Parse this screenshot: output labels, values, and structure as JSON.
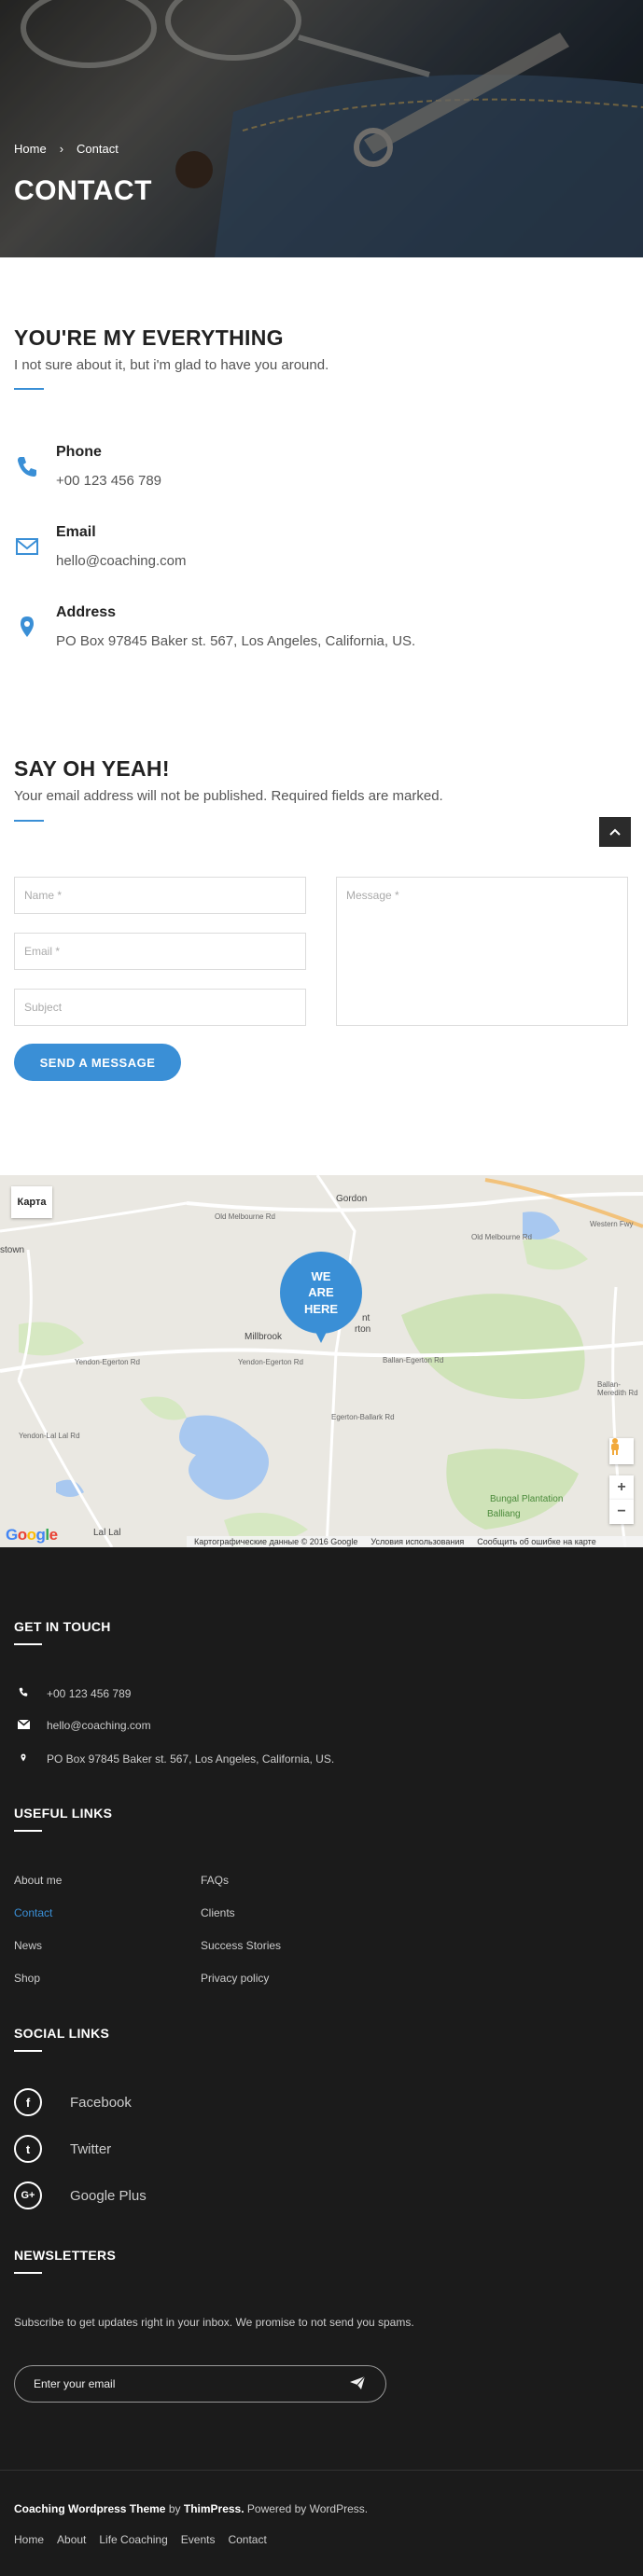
{
  "hero": {
    "breadcrumb": {
      "home": "Home",
      "separator": "›",
      "current": "Contact"
    },
    "title": "CONTACT"
  },
  "intro": {
    "title": "YOU'RE MY EVERYTHING",
    "subtitle": "I not sure about it, but i'm glad to have you around."
  },
  "contacts": [
    {
      "label": "Phone",
      "value": "+00 123 456 789",
      "icon": "phone-icon"
    },
    {
      "label": "Email",
      "value": "hello@coaching.com",
      "icon": "envelope-icon"
    },
    {
      "label": "Address",
      "value": "PO Box 97845 Baker st. 567, Los Angeles, California, US.",
      "icon": "map-pin-icon"
    }
  ],
  "form_section": {
    "title": "SAY OH YEAH!",
    "subtitle": "Your email address will not be published. Required fields are marked.",
    "name_placeholder": "Name *",
    "email_placeholder": "Email *",
    "subject_placeholder": "Subject",
    "message_placeholder": "Message *",
    "submit": "SEND A MESSAGE"
  },
  "map": {
    "type_button": "Карта",
    "marker": {
      "line1": "WE",
      "line2": "ARE",
      "line3": "HERE"
    },
    "places": [
      "Gordon",
      "Millbrook",
      "Lal Lal",
      "Bungal Plantation",
      "Balliang",
      "Yendon-Egerton Rd",
      "Old Melbourne Rd",
      "Western Fwy",
      "Egerton-Ballark Rd",
      "Ballan-Egerton Rd",
      "Ballan-Meredith Rd",
      "Yendon-Lal Lal Rd",
      "Old Melbourne Rd",
      "nt",
      "rton",
      "stown"
    ],
    "footer": {
      "data": "Картографические данные © 2016 Google",
      "terms": "Условия использования",
      "report": "Сообщить об ошибке на карте"
    },
    "google_logo": "Google"
  },
  "footer": {
    "get_in_touch": {
      "title": "GET IN TOUCH",
      "phone": "+00 123 456 789",
      "email": "hello@coaching.com",
      "address": "PO Box 97845 Baker st. 567, Los Angeles, California, US."
    },
    "useful_links": {
      "title": "USEFUL LINKS",
      "col1": [
        "About me",
        "Contact",
        "News",
        "Shop"
      ],
      "col2": [
        "FAQs",
        "Clients",
        "Success Stories",
        "Privacy policy"
      ],
      "active": "Contact"
    },
    "social": {
      "title": "SOCIAL LINKS",
      "items": [
        {
          "name": "Facebook",
          "glyph": "f",
          "icon": "facebook-icon"
        },
        {
          "name": "Twitter",
          "glyph": "t",
          "icon": "twitter-icon"
        },
        {
          "name": "Google Plus",
          "glyph": "G+",
          "icon": "google-plus-icon"
        }
      ]
    },
    "newsletter": {
      "title": "NEWSLETTERS",
      "text": "Subscribe to get updates right in your inbox. We promise to not send you spams.",
      "placeholder": "Enter your email"
    },
    "copyright": {
      "theme": "Coaching Wordpress Theme",
      "by": "by",
      "brand": "ThimPress.",
      "powered": "Powered by WordPress."
    },
    "bottom_nav": [
      "Home",
      "About",
      "Life Coaching",
      "Events",
      "Contact"
    ]
  },
  "colors": {
    "accent": "#3a8fd6",
    "footer_bg": "#1b1b1b"
  }
}
